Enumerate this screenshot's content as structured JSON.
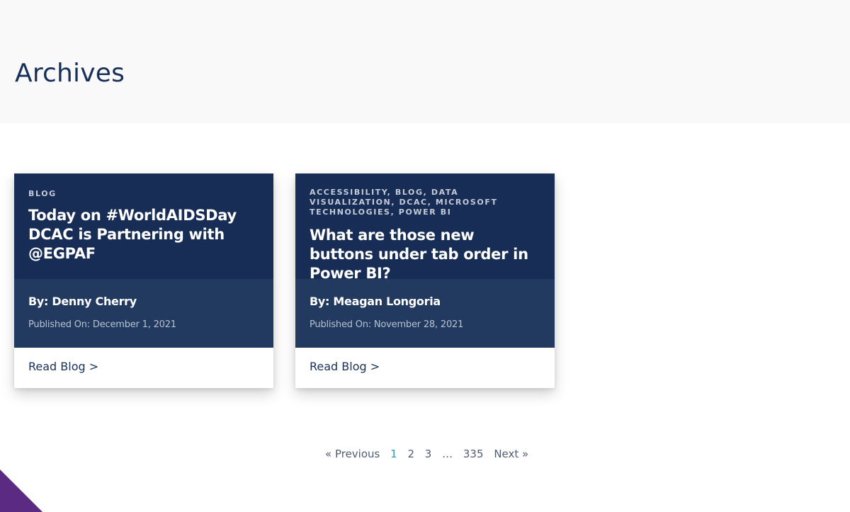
{
  "page": {
    "title": "Archives"
  },
  "posts": [
    {
      "categories": "BLOG",
      "title": "Today on #WorldAIDSDay DCAC is Partnering with @EGPAF",
      "author": "By: Denny Cherry",
      "published": "Published On: December 1, 2021",
      "read_label": "Read Blog >"
    },
    {
      "categories": "ACCESSIBILITY, BLOG, DATA VISUALIZATION, DCAC, MICROSOFT TECHNOLOGIES, POWER BI",
      "title": "What are those new buttons under tab order in Power BI?",
      "author": "By: Meagan Longoria",
      "published": "Published On: November 28, 2021",
      "read_label": "Read Blog >"
    }
  ],
  "pagination": {
    "previous": "« Previous",
    "pages": [
      "1",
      "2",
      "3"
    ],
    "current": "1",
    "ellipsis": "…",
    "last": "335",
    "next": "Next »"
  },
  "colors": {
    "card_top": "#172d55",
    "card_meta": "#223a60",
    "title_text": "#17305a",
    "current_page": "#2b9fb0",
    "corner_accent": "#5b2a83"
  }
}
